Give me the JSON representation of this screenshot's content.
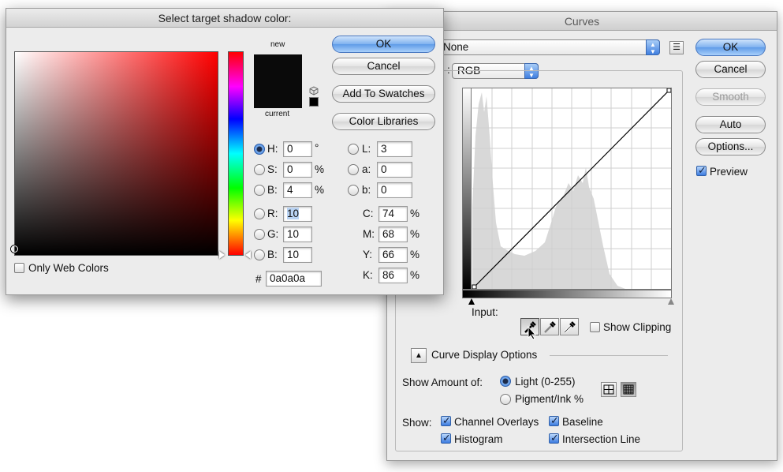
{
  "curves": {
    "title": "Curves",
    "preset_value": "None",
    "channel_label": ":",
    "channel_value": "RGB",
    "buttons": {
      "ok": "OK",
      "cancel": "Cancel",
      "smooth": "Smooth",
      "auto": "Auto",
      "options": "Options..."
    },
    "preview_label": "Preview",
    "preview_checked": true,
    "input_label": "Input:",
    "show_clipping_label": "Show Clipping",
    "curve_display_options_label": "Curve Display Options",
    "show_amount_label": "Show Amount of:",
    "light_label": "Light  (0-255)",
    "pigment_label": "Pigment/Ink %",
    "show_label": "Show:",
    "channel_overlays_label": "Channel Overlays",
    "baseline_label": "Baseline",
    "histogram_label": "Histogram",
    "intersection_line_label": "Intersection Line",
    "checks": {
      "channel_overlays": true,
      "baseline": true,
      "histogram": true,
      "intersection_line": true,
      "show_clipping": false
    }
  },
  "picker": {
    "title": "Select target shadow color:",
    "new_label": "new",
    "current_label": "current",
    "new_color": "#0a0a0a",
    "current_color": "#0a0a0a",
    "buttons": {
      "ok": "OK",
      "cancel": "Cancel",
      "add_to_swatches": "Add To Swatches",
      "color_libraries": "Color Libraries"
    },
    "only_web_colors_label": "Only Web Colors",
    "hsb": [
      {
        "label": "H:",
        "value": "0",
        "unit": "°",
        "selected": true
      },
      {
        "label": "S:",
        "value": "0",
        "unit": "%"
      },
      {
        "label": "B:",
        "value": "4",
        "unit": "%"
      }
    ],
    "rgb": [
      {
        "label": "R:",
        "value": "10"
      },
      {
        "label": "G:",
        "value": "10"
      },
      {
        "label": "B:",
        "value": "10"
      }
    ],
    "lab": [
      {
        "label": "L:",
        "value": "3"
      },
      {
        "label": "a:",
        "value": "0"
      },
      {
        "label": "b:",
        "value": "0"
      }
    ],
    "cmyk": [
      {
        "label": "C:",
        "value": "74",
        "unit": "%"
      },
      {
        "label": "M:",
        "value": "68",
        "unit": "%"
      },
      {
        "label": "Y:",
        "value": "66",
        "unit": "%"
      },
      {
        "label": "K:",
        "value": "86",
        "unit": "%"
      }
    ],
    "hex_label": "#",
    "hex_value": "0a0a0a"
  },
  "colors": {
    "accent": "#3f7fe0"
  }
}
